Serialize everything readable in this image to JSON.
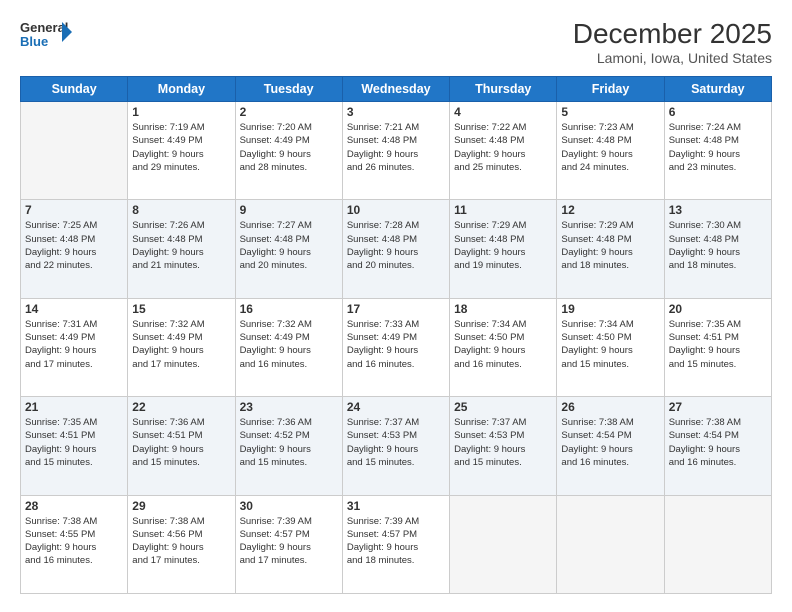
{
  "header": {
    "logo_line1": "General",
    "logo_line2": "Blue",
    "month": "December 2025",
    "location": "Lamoni, Iowa, United States"
  },
  "days_of_week": [
    "Sunday",
    "Monday",
    "Tuesday",
    "Wednesday",
    "Thursday",
    "Friday",
    "Saturday"
  ],
  "weeks": [
    [
      {
        "day": "",
        "data": ""
      },
      {
        "day": "1",
        "data": "Sunrise: 7:19 AM\nSunset: 4:49 PM\nDaylight: 9 hours\nand 29 minutes."
      },
      {
        "day": "2",
        "data": "Sunrise: 7:20 AM\nSunset: 4:49 PM\nDaylight: 9 hours\nand 28 minutes."
      },
      {
        "day": "3",
        "data": "Sunrise: 7:21 AM\nSunset: 4:48 PM\nDaylight: 9 hours\nand 26 minutes."
      },
      {
        "day": "4",
        "data": "Sunrise: 7:22 AM\nSunset: 4:48 PM\nDaylight: 9 hours\nand 25 minutes."
      },
      {
        "day": "5",
        "data": "Sunrise: 7:23 AM\nSunset: 4:48 PM\nDaylight: 9 hours\nand 24 minutes."
      },
      {
        "day": "6",
        "data": "Sunrise: 7:24 AM\nSunset: 4:48 PM\nDaylight: 9 hours\nand 23 minutes."
      }
    ],
    [
      {
        "day": "7",
        "data": "Sunrise: 7:25 AM\nSunset: 4:48 PM\nDaylight: 9 hours\nand 22 minutes."
      },
      {
        "day": "8",
        "data": "Sunrise: 7:26 AM\nSunset: 4:48 PM\nDaylight: 9 hours\nand 21 minutes."
      },
      {
        "day": "9",
        "data": "Sunrise: 7:27 AM\nSunset: 4:48 PM\nDaylight: 9 hours\nand 20 minutes."
      },
      {
        "day": "10",
        "data": "Sunrise: 7:28 AM\nSunset: 4:48 PM\nDaylight: 9 hours\nand 20 minutes."
      },
      {
        "day": "11",
        "data": "Sunrise: 7:29 AM\nSunset: 4:48 PM\nDaylight: 9 hours\nand 19 minutes."
      },
      {
        "day": "12",
        "data": "Sunrise: 7:29 AM\nSunset: 4:48 PM\nDaylight: 9 hours\nand 18 minutes."
      },
      {
        "day": "13",
        "data": "Sunrise: 7:30 AM\nSunset: 4:48 PM\nDaylight: 9 hours\nand 18 minutes."
      }
    ],
    [
      {
        "day": "14",
        "data": "Sunrise: 7:31 AM\nSunset: 4:49 PM\nDaylight: 9 hours\nand 17 minutes."
      },
      {
        "day": "15",
        "data": "Sunrise: 7:32 AM\nSunset: 4:49 PM\nDaylight: 9 hours\nand 17 minutes."
      },
      {
        "day": "16",
        "data": "Sunrise: 7:32 AM\nSunset: 4:49 PM\nDaylight: 9 hours\nand 16 minutes."
      },
      {
        "day": "17",
        "data": "Sunrise: 7:33 AM\nSunset: 4:49 PM\nDaylight: 9 hours\nand 16 minutes."
      },
      {
        "day": "18",
        "data": "Sunrise: 7:34 AM\nSunset: 4:50 PM\nDaylight: 9 hours\nand 16 minutes."
      },
      {
        "day": "19",
        "data": "Sunrise: 7:34 AM\nSunset: 4:50 PM\nDaylight: 9 hours\nand 15 minutes."
      },
      {
        "day": "20",
        "data": "Sunrise: 7:35 AM\nSunset: 4:51 PM\nDaylight: 9 hours\nand 15 minutes."
      }
    ],
    [
      {
        "day": "21",
        "data": "Sunrise: 7:35 AM\nSunset: 4:51 PM\nDaylight: 9 hours\nand 15 minutes."
      },
      {
        "day": "22",
        "data": "Sunrise: 7:36 AM\nSunset: 4:51 PM\nDaylight: 9 hours\nand 15 minutes."
      },
      {
        "day": "23",
        "data": "Sunrise: 7:36 AM\nSunset: 4:52 PM\nDaylight: 9 hours\nand 15 minutes."
      },
      {
        "day": "24",
        "data": "Sunrise: 7:37 AM\nSunset: 4:53 PM\nDaylight: 9 hours\nand 15 minutes."
      },
      {
        "day": "25",
        "data": "Sunrise: 7:37 AM\nSunset: 4:53 PM\nDaylight: 9 hours\nand 15 minutes."
      },
      {
        "day": "26",
        "data": "Sunrise: 7:38 AM\nSunset: 4:54 PM\nDaylight: 9 hours\nand 16 minutes."
      },
      {
        "day": "27",
        "data": "Sunrise: 7:38 AM\nSunset: 4:54 PM\nDaylight: 9 hours\nand 16 minutes."
      }
    ],
    [
      {
        "day": "28",
        "data": "Sunrise: 7:38 AM\nSunset: 4:55 PM\nDaylight: 9 hours\nand 16 minutes."
      },
      {
        "day": "29",
        "data": "Sunrise: 7:38 AM\nSunset: 4:56 PM\nDaylight: 9 hours\nand 17 minutes."
      },
      {
        "day": "30",
        "data": "Sunrise: 7:39 AM\nSunset: 4:57 PM\nDaylight: 9 hours\nand 17 minutes."
      },
      {
        "day": "31",
        "data": "Sunrise: 7:39 AM\nSunset: 4:57 PM\nDaylight: 9 hours\nand 18 minutes."
      },
      {
        "day": "",
        "data": ""
      },
      {
        "day": "",
        "data": ""
      },
      {
        "day": "",
        "data": ""
      }
    ]
  ]
}
